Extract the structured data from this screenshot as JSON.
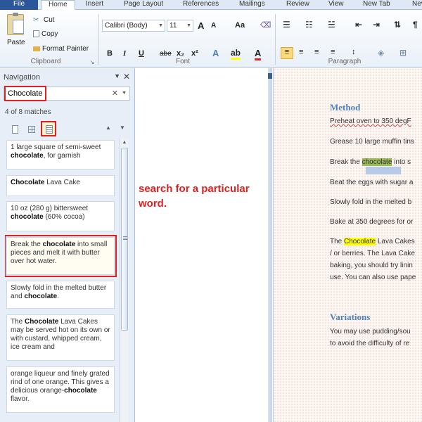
{
  "ribbon": {
    "tabs": [
      "File",
      "Home",
      "Insert",
      "Page Layout",
      "References",
      "Mailings",
      "Review",
      "View",
      "New Tab",
      "Nev"
    ],
    "clipboard": {
      "paste": "Paste",
      "cut": "Cut",
      "copy": "Copy",
      "format_painter": "Format Painter",
      "label": "Clipboard"
    },
    "font": {
      "name": "Calibri (Body)",
      "size": "11",
      "bold": "B",
      "italic": "I",
      "underline": "U",
      "strike": "abe",
      "sub": "x₂",
      "sup": "x²",
      "grow": "A",
      "shrink": "A",
      "change_case": "Aa",
      "label": "Font"
    },
    "paragraph": {
      "label": "Paragraph",
      "pilcrow": "¶"
    }
  },
  "nav": {
    "title": "Navigation",
    "search_value": "Chocolate",
    "match_count": "4 of 8 matches",
    "results": [
      {
        "pre": "1 large square of semi-sweet ",
        "term": "chocolate",
        "post": ", for garnish"
      },
      {
        "pre": "",
        "term": "Chocolate",
        "post": " Lava Cake"
      },
      {
        "pre": "10 oz (280 g) bittersweet ",
        "term": "chocolate",
        "post": " (60% cocoa)"
      },
      {
        "pre": "Break the ",
        "term": "chocolate",
        "post": " into small pieces and melt it with butter over hot water."
      },
      {
        "pre": "Slowly fold in the melted butter and ",
        "term": "chocolate",
        "post": "."
      },
      {
        "pre": "The ",
        "term": "Chocolate",
        "post": " Lava Cakes may be served hot on its own or with custard, whipped cream, ice cream and"
      },
      {
        "pre": "orange liqueur and finely grated rind of one orange. This gives a delicious orange-",
        "term": "chocolate",
        "post": " flavor."
      }
    ]
  },
  "annotation": "search for a particular word.",
  "document": {
    "heading1": "Method",
    "lines": [
      "Preheat oven to 350 degF",
      "Grease 10 large muffin tins",
      "Break the chocolate into s",
      "Beat the eggs with sugar a",
      "Slowly fold in the melted b",
      "Bake at 350 degrees for or",
      "The Chocolate Lava Cakes",
      "/ or berries. The Lava Cake",
      "baking, you should try linin",
      "use. You can also use pape"
    ],
    "heading2": "Variations",
    "lines2": [
      "You may use pudding/sou",
      "to avoid the difficulty of re"
    ]
  }
}
